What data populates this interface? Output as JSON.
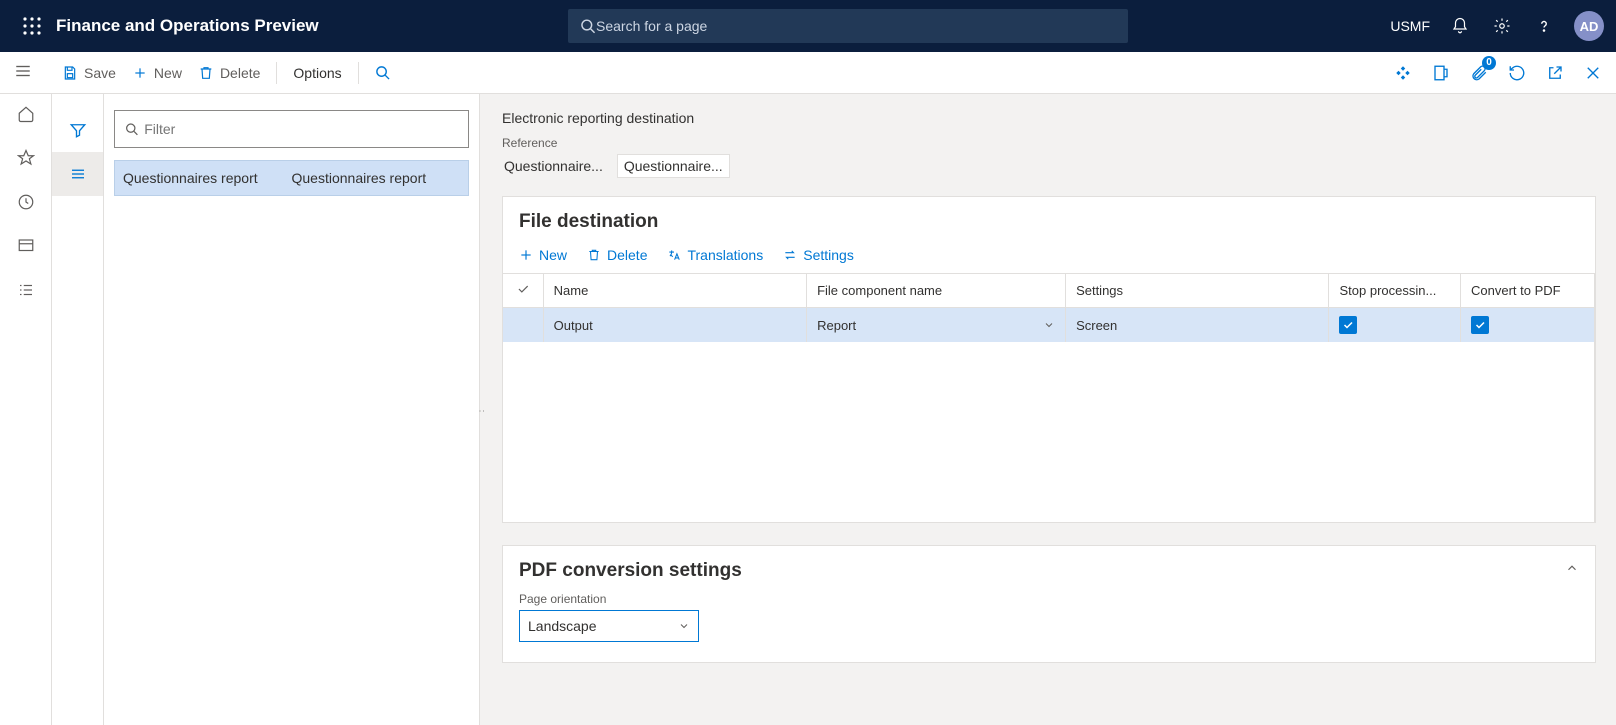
{
  "header": {
    "app_title": "Finance and Operations Preview",
    "search_placeholder": "Search for a page",
    "company": "USMF",
    "avatar_initials": "AD",
    "notification_badge": "0"
  },
  "action_bar": {
    "save": "Save",
    "new": "New",
    "delete": "Delete",
    "options": "Options"
  },
  "list_pane": {
    "filter_placeholder": "Filter",
    "rows": [
      {
        "col1": "Questionnaires report",
        "col2": "Questionnaires report"
      }
    ]
  },
  "detail": {
    "page_heading": "Electronic reporting destination",
    "reference_label": "Reference",
    "reference_values": [
      "Questionnaire...",
      "Questionnaire..."
    ]
  },
  "file_destination": {
    "title": "File destination",
    "toolbar": {
      "new": "New",
      "delete": "Delete",
      "translations": "Translations",
      "settings": "Settings"
    },
    "columns": {
      "name": "Name",
      "file_component": "File component name",
      "settings": "Settings",
      "stop_processing": "Stop processin...",
      "convert_pdf": "Convert to PDF"
    },
    "rows": [
      {
        "name": "Output",
        "file_component": "Report",
        "settings": "Screen",
        "stop_processing": true,
        "convert_pdf": true
      }
    ]
  },
  "pdf_settings": {
    "title": "PDF conversion settings",
    "page_orientation_label": "Page orientation",
    "page_orientation_value": "Landscape"
  }
}
